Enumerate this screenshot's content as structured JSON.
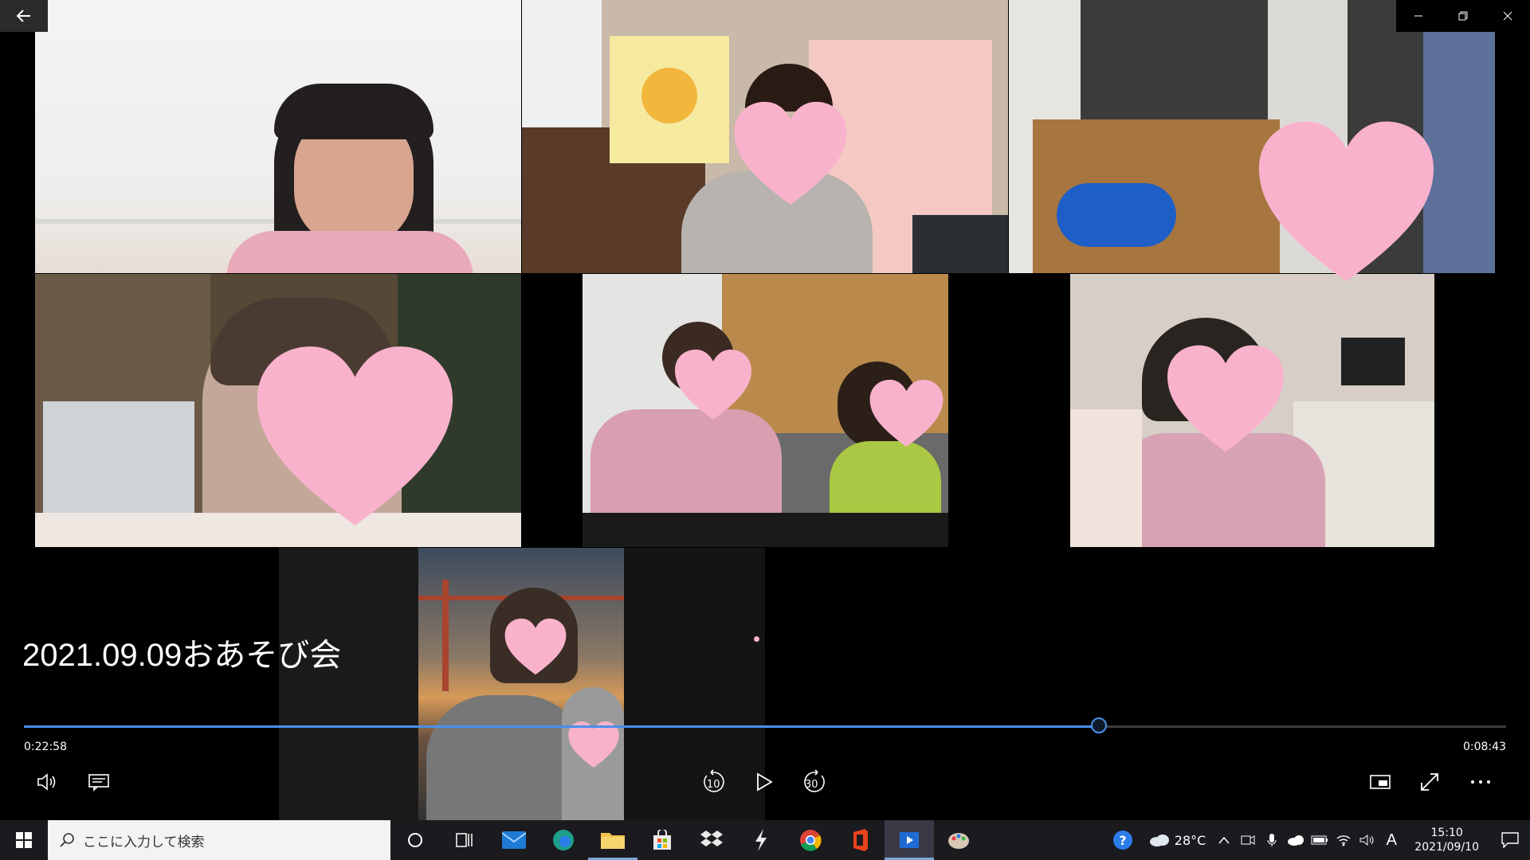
{
  "window": {
    "back_icon": "back-arrow-icon",
    "minimize_icon": "minimize-icon",
    "restore_icon": "restore-icon",
    "close_icon": "close-icon"
  },
  "video": {
    "title": "2021.09.09おあそび会",
    "elapsed": "0:22:58",
    "remaining": "0:08:43",
    "progress_fraction": 0.725,
    "accent_color": "#4a8fe7",
    "participant_tiles": 7,
    "heart_color": "#f9b2cc"
  },
  "controls": {
    "volume_icon": "volume-icon",
    "captions_icon": "captions-icon",
    "skip_back_icon": "skip-back-10-icon",
    "skip_back_label": "10",
    "play_icon": "play-icon",
    "skip_forward_icon": "skip-forward-30-icon",
    "skip_forward_label": "30",
    "miniview_icon": "miniview-icon",
    "fullscreen_icon": "fullscreen-icon",
    "more_icon": "more-icon"
  },
  "taskbar": {
    "search_placeholder": "ここに入力して検索",
    "apps": [
      "cortana-icon",
      "task-view-icon",
      "mail-icon",
      "edge-icon",
      "file-explorer-icon",
      "store-icon",
      "dropbox-icon",
      "winamp-icon",
      "chrome-icon",
      "office-icon",
      "movies-tv-icon",
      "paint-icon"
    ],
    "weather_temp": "28°C",
    "ime_label": "A",
    "time": "15:10",
    "date": "2021/09/10"
  }
}
